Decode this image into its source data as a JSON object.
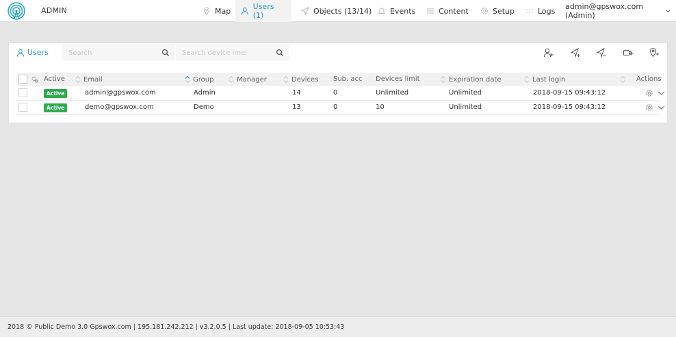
{
  "app": {
    "brand": "ADMIN",
    "logo_icon": "signal-tower-icon",
    "accent_color": "#2f94c4"
  },
  "nav": {
    "map": {
      "label": "Map",
      "icon": "map-marker-icon"
    },
    "users": {
      "label": "Users (1)",
      "icon": "user-icon",
      "active": true
    },
    "objects": {
      "label": "Objects (13/14)",
      "icon": "navigation-arrow-icon"
    },
    "events": {
      "label": "Events",
      "icon": "bell-icon"
    },
    "content": {
      "label": "Content",
      "icon": "list-icon"
    },
    "setup": {
      "label": "Setup",
      "icon": "gear-icon"
    },
    "logs": {
      "label": "Logs",
      "icon": "dots-icon"
    },
    "account": {
      "label": "admin@gpswox.com (Admin)",
      "icon": "chevron-down-icon"
    }
  },
  "panel": {
    "title": "Users",
    "search_placeholder": "Search",
    "imei_placeholder": "Search device imei",
    "tools": [
      "add-user-icon",
      "add-object-icon",
      "add-object-alt-icon",
      "add-camera-icon",
      "add-geofence-icon"
    ]
  },
  "table": {
    "headers": {
      "active": "Active",
      "email": "Email",
      "group": "Group",
      "manager": "Manager",
      "devices": "Devices",
      "sub_acc": "Sub. acc",
      "devices_limit": "Devices limit",
      "expiration": "Expiration date",
      "last_login": "Last login",
      "actions": "Actions"
    },
    "rows": [
      {
        "status": "Active",
        "email": "admin@gpswox.com",
        "group": "Admin",
        "manager": "",
        "devices": "14",
        "sub_acc": "0",
        "devices_limit": "Unlimited",
        "expiration": "Unlimited",
        "last_login": "2018-09-15 09:43:12"
      },
      {
        "status": "Active",
        "email": "demo@gpswox.com",
        "group": "Demo",
        "manager": "",
        "devices": "13",
        "sub_acc": "0",
        "devices_limit": "10",
        "expiration": "Unlimited",
        "last_login": "2018-09-15 09:43:12"
      }
    ]
  },
  "footer": {
    "text": "2018 © Public Demo 3.0 Gpswox.com | 195.181.242.212 | v3.2.0.5 | Last update: 2018-09-05 10:53:43"
  }
}
